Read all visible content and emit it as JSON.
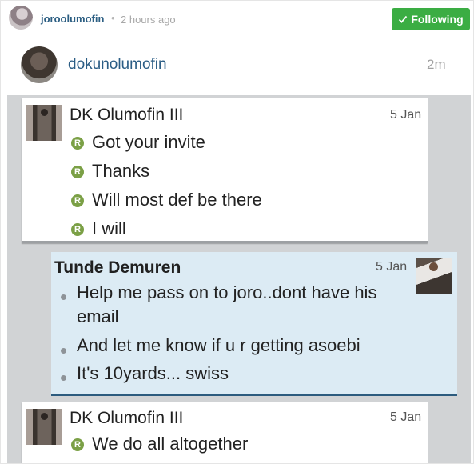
{
  "post": {
    "username": "joroolumofin",
    "separator": "•",
    "time": "2 hours ago",
    "follow_label": "Following"
  },
  "comment": {
    "username": "dokunolumofin",
    "time": "2m"
  },
  "conversation": {
    "message1": {
      "sender": "DK Olumofin III",
      "date": "5 Jan",
      "lines": [
        "Got your invite",
        "Thanks",
        "Will most def be there",
        "I will"
      ],
      "marker": "R"
    },
    "message2": {
      "sender": "Tunde Demuren",
      "date": "5 Jan",
      "lines": [
        "Help me pass on to joro..dont have his",
        "email",
        "And let me know if u r getting asoebi",
        "It's 10yards... swiss"
      ]
    },
    "message3": {
      "sender": "DK Olumofin III",
      "date": "5 Jan",
      "lines": [
        "We do all altogether"
      ],
      "marker": "R"
    }
  },
  "colors": {
    "follow_button": "#3bad43",
    "username": "#2d5f83",
    "read_marker": "#7ba046",
    "highlight_bg": "#dcebf4",
    "highlight_underline": "#2c5b7e"
  }
}
